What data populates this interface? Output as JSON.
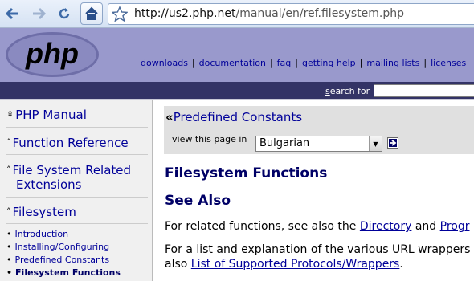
{
  "browser": {
    "url_domain": "http://us2.php.net",
    "url_path": "/manual/en/ref.filesystem.php"
  },
  "header": {
    "logo_text": "php",
    "links": [
      "downloads",
      "documentation",
      "faq",
      "getting help",
      "mailing lists",
      "licenses"
    ],
    "search_label_accel": "s",
    "search_label_rest": "earch for"
  },
  "sidebar": {
    "items": [
      {
        "label": "PHP Manual"
      },
      {
        "label": "Function Reference"
      },
      {
        "label_line1": "File System Related",
        "label_line2": "Extensions"
      },
      {
        "label": "Filesystem"
      }
    ],
    "subitems": [
      "Introduction",
      "Installing/Configuring",
      "Predefined Constants",
      "Filesystem Functions"
    ]
  },
  "main": {
    "prev_link": "Predefined Constants",
    "view_label": "view this page in",
    "language_selected": "Bulgarian",
    "title": "Filesystem Functions",
    "see_also": "See Also",
    "para1_prefix": "For related functions, see also the ",
    "para1_link1": "Directory",
    "para1_and": " and ",
    "para1_link2": "Progr",
    "para2_line1": "For a list and explanation of the various URL wrappers",
    "para2_also": "also ",
    "para2_link": "List of Supported Protocols/Wrappers",
    "para2_end": "."
  },
  "colors": {
    "header_bg": "#9999cc",
    "search_bar_bg": "#333366",
    "link": "#000099",
    "heading": "#000066"
  }
}
